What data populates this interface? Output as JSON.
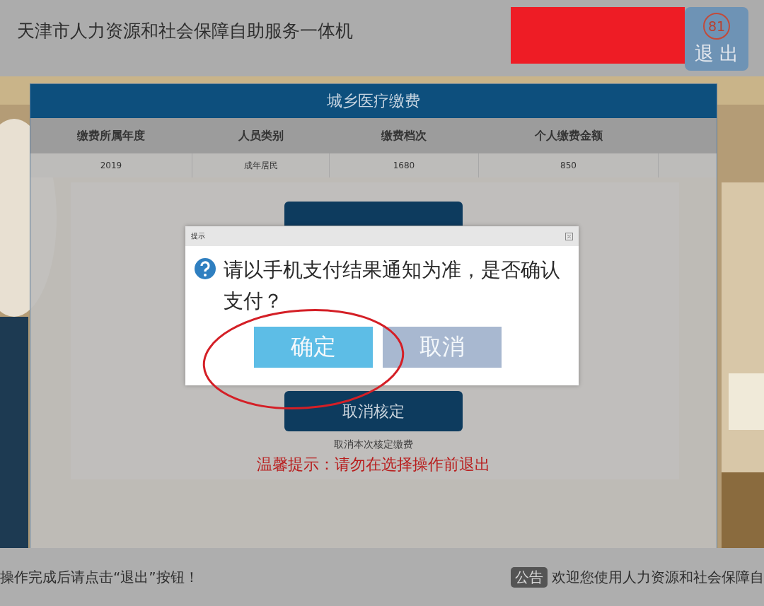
{
  "header": {
    "title": "天津市人力资源和社会保障自助服务一体机",
    "countdown": "81",
    "exit_label": "退出"
  },
  "panel": {
    "title": "城乡医疗缴费",
    "table": {
      "columns": [
        "缴费所属年度",
        "人员类别",
        "缴费档次",
        "个人缴费金额"
      ],
      "rows": [
        [
          "2019",
          "成年居民",
          "1680",
          "850"
        ]
      ]
    },
    "actions": [
      {
        "kind": "covered"
      },
      {
        "kind": "button",
        "label": "取消核定",
        "caption": "取消本次核定缴费"
      }
    ],
    "warning": "温馨提示：请勿在选择操作前退出"
  },
  "dialog": {
    "title": "提示",
    "message": "请以手机支付结果通知为准，是否确认支付？",
    "buttons": [
      {
        "label": "确定",
        "kind": "primary"
      },
      {
        "label": "取消",
        "kind": "secondary"
      }
    ]
  },
  "footer": {
    "notice": "操作完成后请点击“退出”按钮！",
    "badge": "公告",
    "announcement": "欢迎您使用人力资源和社会保障自"
  }
}
